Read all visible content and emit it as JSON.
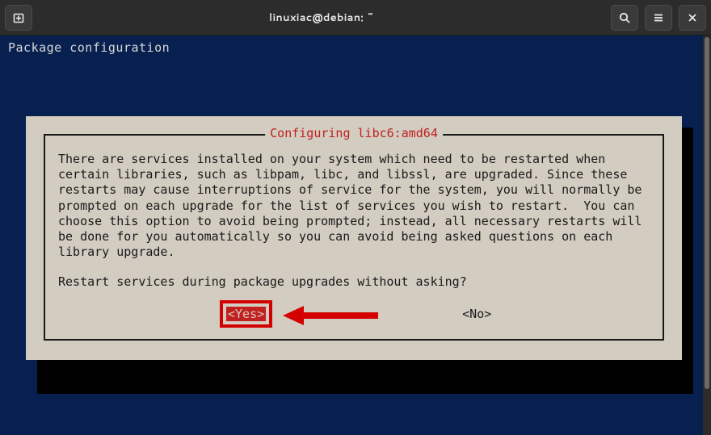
{
  "titlebar": {
    "title": "linuxiac@debian: ~"
  },
  "terminal": {
    "header": "Package configuration"
  },
  "dialog": {
    "title": "Configuring libc6:amd64",
    "body": "There are services installed on your system which need to be restarted when certain libraries, such as libpam, libc, and libssl, are upgraded. Since these restarts may cause interruptions of service for the system, you will normally be prompted on each upgrade for the list of services you wish to restart.  You can choose this option to avoid being prompted; instead, all necessary restarts will be done for you automatically so you can avoid being asked questions on each library upgrade.",
    "question": "Restart services during package upgrades without asking?",
    "yes_label": "<Yes>",
    "no_label": "<No>"
  }
}
